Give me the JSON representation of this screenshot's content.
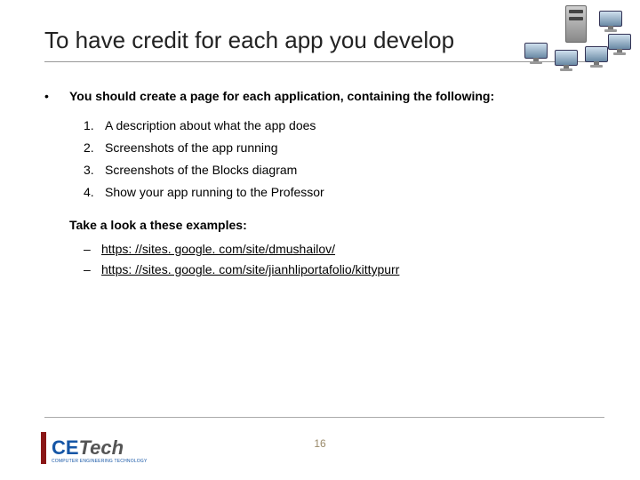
{
  "title": "To have credit for each app you develop",
  "intro": "You should create a page for each application, containing the following:",
  "items": [
    "A description about what the app does",
    "Screenshots of the app running",
    "Screenshots of the Blocks diagram",
    "Show your app running to the Professor"
  ],
  "examples_heading": "Take a look a these examples:",
  "links": [
    "https: //sites. google. com/site/dmushailov/",
    "https: //sites. google. com/site/jianhliportafolio/kittypurr"
  ],
  "page_number": "16",
  "logo": {
    "ce": "CE",
    "tech": "Tech",
    "sub": "COMPUTER ENGINEERING TECHNOLOGY"
  }
}
